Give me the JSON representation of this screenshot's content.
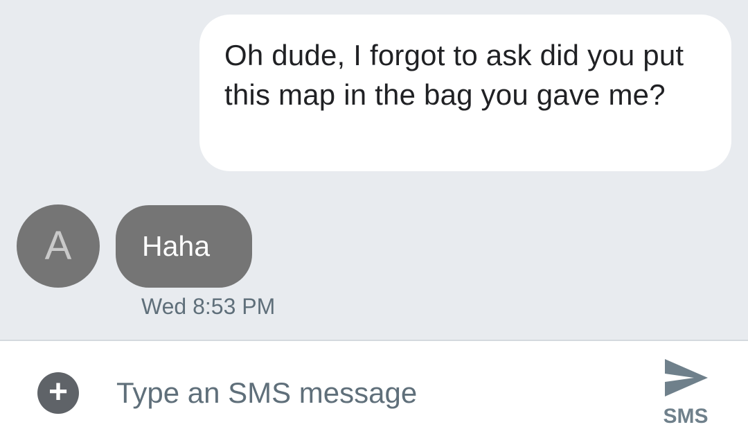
{
  "conversation": {
    "outgoing_message": "Oh dude, I forgot to ask did you put this map in the bag you gave me?",
    "incoming": {
      "avatar_letter": "A",
      "message": "Haha",
      "timestamp": "Wed 8:53 PM"
    }
  },
  "compose": {
    "add_icon": "+",
    "placeholder": "Type an SMS message",
    "value": "",
    "send_icon": "send-arrow-icon",
    "send_label": "SMS"
  },
  "colors": {
    "background": "#e8ebef",
    "outgoing_bubble": "#ffffff",
    "incoming_bubble": "#757575",
    "avatar": "#757575",
    "send_icon": "#6f808b",
    "muted_text": "#5f6f7a"
  }
}
